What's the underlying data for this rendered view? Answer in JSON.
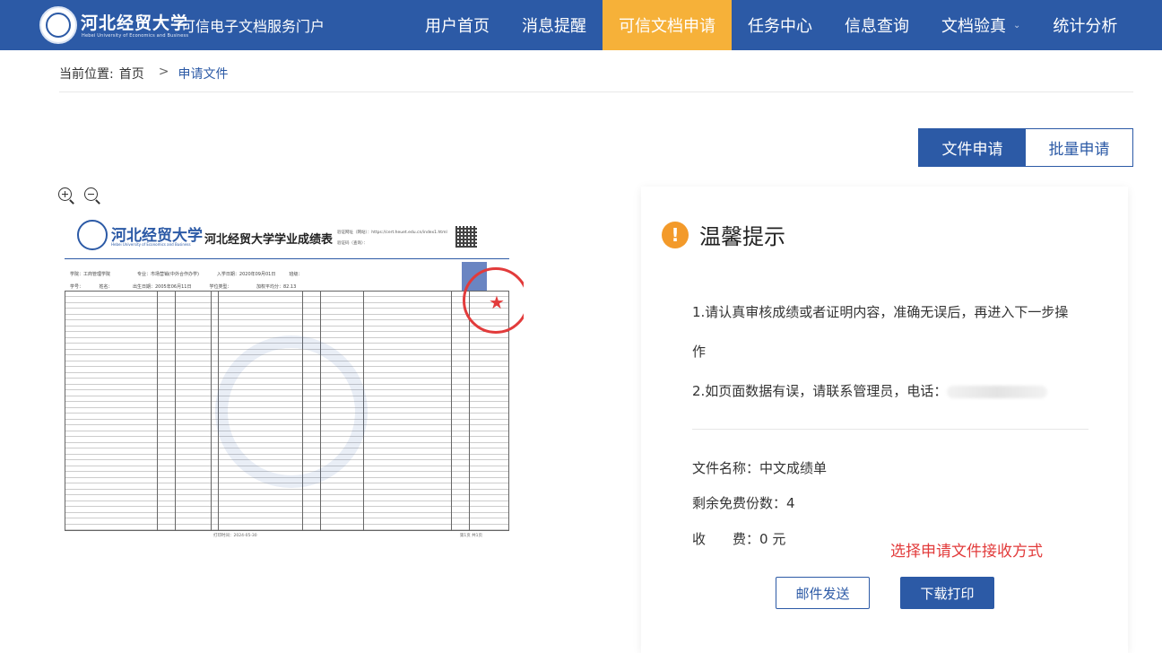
{
  "header": {
    "logo_cn": "河北经贸大学",
    "logo_en": "Hebei University of Economics and Business",
    "portal_title": "可信电子文档服务门户",
    "nav": [
      {
        "label": "用户首页",
        "active": false
      },
      {
        "label": "消息提醒",
        "active": false
      },
      {
        "label": "可信文档申请",
        "active": true
      },
      {
        "label": "任务中心",
        "active": false
      },
      {
        "label": "信息查询",
        "active": false
      },
      {
        "label": "文档验真",
        "active": false
      },
      {
        "label": "统计分析",
        "active": false
      }
    ],
    "colors": {
      "bar": "#2c5aa6",
      "active": "#f6b139"
    }
  },
  "breadcrumb": {
    "prefix": "当前位置:",
    "home": "首页",
    "separator": ">",
    "current": "申请文件"
  },
  "segment": {
    "single": "文件申请",
    "batch": "批量申请"
  },
  "zoom": {
    "in_icon": "zoom-in-icon",
    "out_icon": "zoom-out-icon"
  },
  "document": {
    "logo_cn": "河北经贸大学",
    "logo_en": "Hebei University of Economics and Business",
    "title": "河北经贸大学学业成绩表",
    "meta_line1": "验证网址（网站）：https://cert.heuet.edu.cn/index1.html",
    "meta_line2": "验证码（查询）：",
    "info_line1": "学院：工商管理学院　　　　　　专业：市场营销(中外合作办学)　　　　入学日期：2020年09月01日　　　班级：",
    "info_line2": "学号：　　　　姓名：　　　　　出生日期：2005年06月11日　　　　学位类型：　　　　　　加权平均分：82.13",
    "print_time": "打印时间：2024-05-30",
    "page_no": "第1页 共1页"
  },
  "tips": {
    "title": "温馨提示",
    "line1": "1.请认真审核成绩或者证明内容，准确无误后，再进入下一步操作",
    "line2": "2.如页面数据有误，请联系管理员，电话："
  },
  "file_info": {
    "name_label": "文件名称：",
    "name_value": "中文成绩单",
    "remaining_label": "剩余免费份数：",
    "remaining_value": "4",
    "fee_label": "收　　费：",
    "fee_value": "0 元"
  },
  "delivery": {
    "prompt": "选择申请文件接收方式",
    "email_button": "邮件发送",
    "download_button": "下载打印"
  }
}
